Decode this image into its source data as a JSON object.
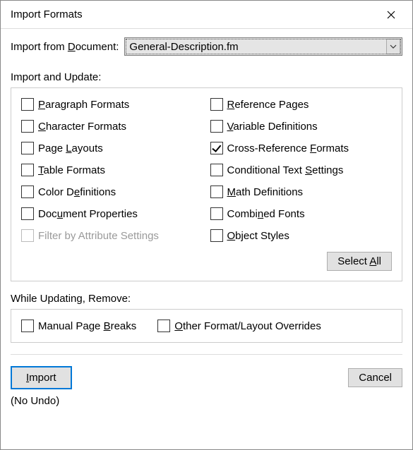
{
  "title": "Import Formats",
  "doc_label_pre": "Import from ",
  "doc_label_ul": "D",
  "doc_label_post": "ocument:",
  "document": "General-Description.fm",
  "import_update_label": "Import and Update:",
  "options": {
    "paragraph": {
      "pre": "",
      "ul": "P",
      "post": "aragraph Formats",
      "checked": false,
      "disabled": false
    },
    "reference": {
      "pre": "",
      "ul": "R",
      "post": "eference Pages",
      "checked": false,
      "disabled": false
    },
    "character": {
      "pre": "",
      "ul": "C",
      "post": "haracter Formats",
      "checked": false,
      "disabled": false
    },
    "variable": {
      "pre": "",
      "ul": "V",
      "post": "ariable Definitions",
      "checked": false,
      "disabled": false
    },
    "pagelayouts": {
      "pre": "Page ",
      "ul": "L",
      "post": "ayouts",
      "checked": false,
      "disabled": false
    },
    "crossref": {
      "pre": "Cross-Reference ",
      "ul": "F",
      "post": "ormats",
      "checked": true,
      "disabled": false
    },
    "table": {
      "pre": "",
      "ul": "T",
      "post": "able Formats",
      "checked": false,
      "disabled": false
    },
    "condtext": {
      "pre": "Conditional Text ",
      "ul": "S",
      "post": "ettings",
      "checked": false,
      "disabled": false
    },
    "colordef": {
      "pre": "Color D",
      "ul": "e",
      "post": "finitions",
      "checked": false,
      "disabled": false
    },
    "math": {
      "pre": "",
      "ul": "M",
      "post": "ath Definitions",
      "checked": false,
      "disabled": false
    },
    "docprops": {
      "pre": "Doc",
      "ul": "u",
      "post": "ment Properties",
      "checked": false,
      "disabled": false
    },
    "combined": {
      "pre": "Combi",
      "ul": "n",
      "post": "ed Fonts",
      "checked": false,
      "disabled": false
    },
    "filterattr": {
      "pre": "Filter by Attribute Settings",
      "ul": "",
      "post": "",
      "checked": false,
      "disabled": true
    },
    "objstyles": {
      "pre": "",
      "ul": "O",
      "post": "bject Styles",
      "checked": false,
      "disabled": false
    }
  },
  "select_all_pre": "Select ",
  "select_all_ul": "A",
  "select_all_post": "ll",
  "while_updating_label": "While Updating, Remove:",
  "remove": {
    "pagebreaks": {
      "pre": "Manual Page ",
      "ul": "B",
      "post": "reaks",
      "checked": false
    },
    "overrides": {
      "pre": "",
      "ul": "O",
      "post": "ther Format/Layout Overrides",
      "checked": false
    }
  },
  "import_btn_ul": "I",
  "import_btn_post": "mport",
  "cancel_btn": "Cancel",
  "no_undo": "(No Undo)"
}
